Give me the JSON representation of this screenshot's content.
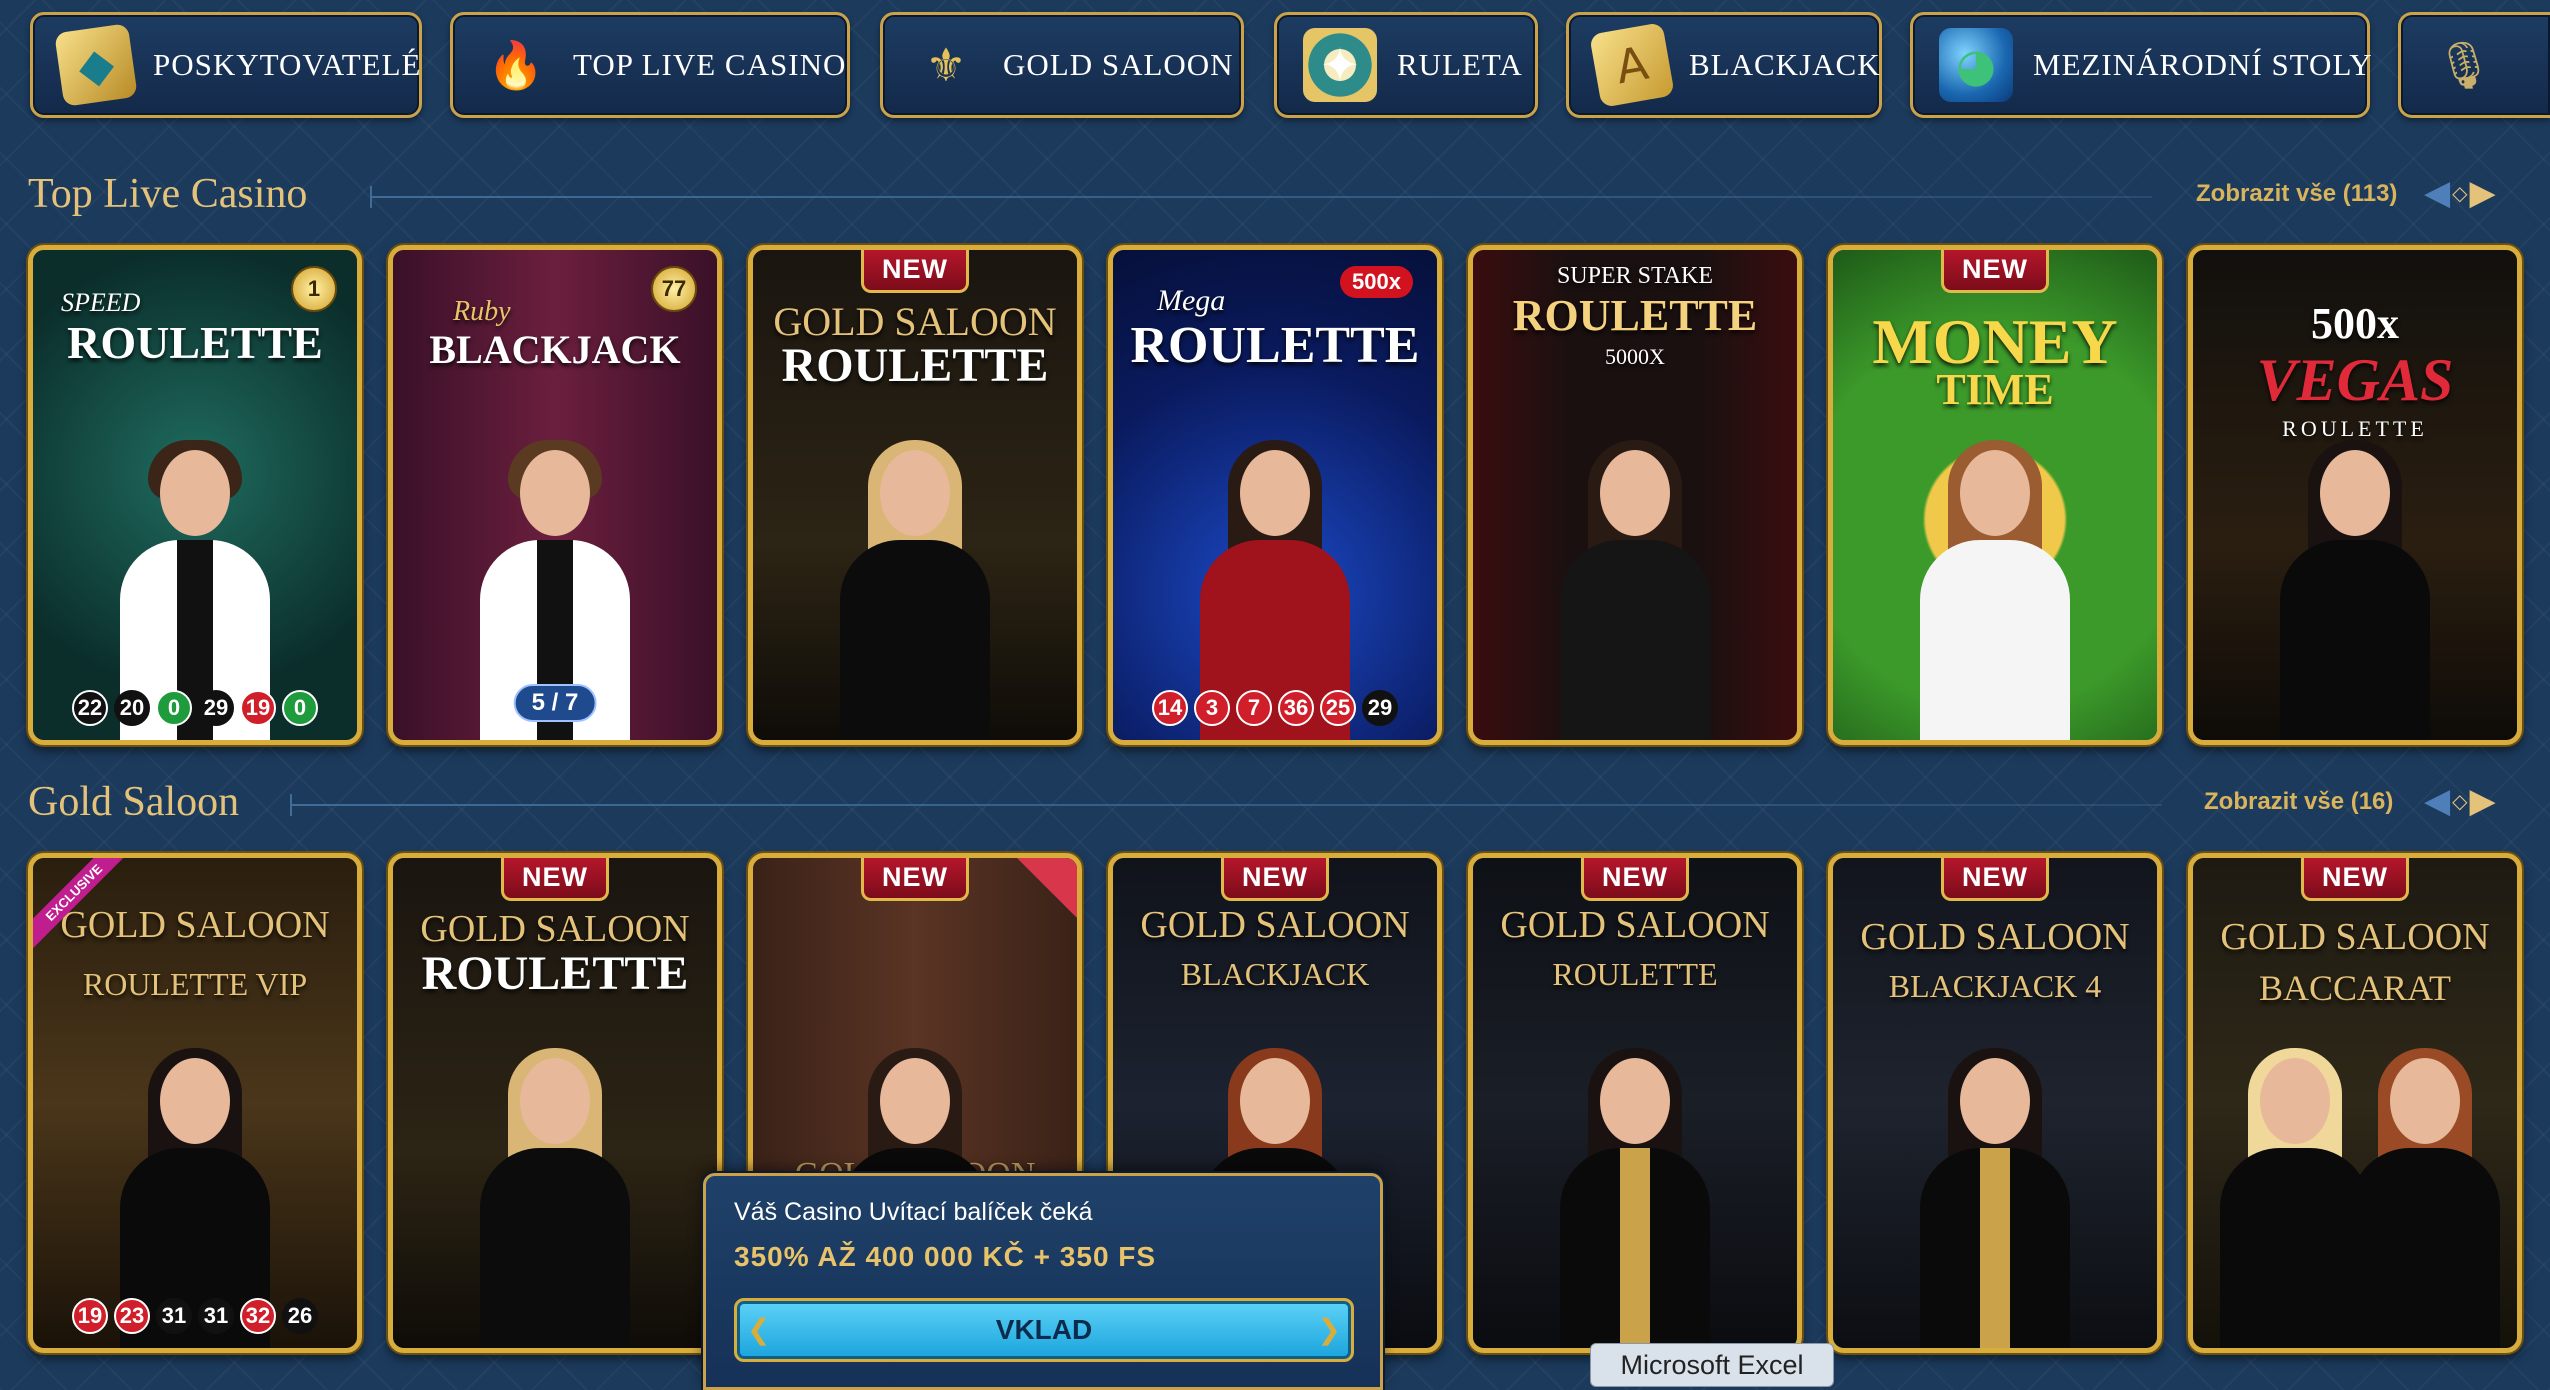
{
  "categories": [
    {
      "label": "POSKYTOVATELÉ",
      "icon": "providers-icon"
    },
    {
      "label": "TOP LIVE CASINO",
      "icon": "torch-icon"
    },
    {
      "label": "GOLD SALOON",
      "icon": "fleur-de-lis-icon"
    },
    {
      "label": "RULETA",
      "icon": "roulette-wheel-icon"
    },
    {
      "label": "BLACKJACK",
      "icon": "cards-icon"
    },
    {
      "label": "MEZINÁRODNÍ STOLY",
      "icon": "globe-icon"
    },
    {
      "label": "",
      "icon": "microphone-icon"
    }
  ],
  "sections": {
    "top_live": {
      "title": "Top Live Casino",
      "show_all": "Zobrazit vše (113)",
      "cards": [
        {
          "title": "ROULETTE",
          "subtitle": "SPEED",
          "badge": "1",
          "results": [
            "22",
            "20",
            "0",
            "29",
            "19",
            "0"
          ]
        },
        {
          "title": "BLACKJACK",
          "subtitle": "Ruby",
          "badge": "77",
          "players": "5 / 7"
        },
        {
          "new": "NEW",
          "title": "ROULETTE",
          "subtitle": "GOLD SALOON"
        },
        {
          "title": "ROULETTE",
          "subtitle": "Mega",
          "multiplier": "500x",
          "results": [
            "14",
            "3",
            "7",
            "36",
            "25",
            "29"
          ]
        },
        {
          "title": "ROULETTE",
          "subtitle": "SUPER STAKE",
          "tag": "5000X"
        },
        {
          "new": "NEW",
          "title": "MONEY",
          "subtitle": "TIME"
        },
        {
          "title": "VEGAS",
          "subtitle": "500x",
          "tag": "ROULETTE"
        }
      ]
    },
    "gold_saloon": {
      "title": "Gold Saloon",
      "show_all": "Zobrazit vše (16)",
      "cards": [
        {
          "title": "GOLD SALOON",
          "subtitle": "ROULETTE VIP",
          "exclusive": "EXCLUSIVE",
          "results": [
            "19",
            "23",
            "31",
            "31",
            "32",
            "26"
          ]
        },
        {
          "new": "NEW",
          "title": "GOLD SALOON",
          "subtitle": "ROULETTE"
        },
        {
          "new": "NEW",
          "title": "GOLD SALOON",
          "subtitle": ""
        },
        {
          "new": "NEW",
          "title": "GOLD SALOON",
          "subtitle": "BLACKJACK"
        },
        {
          "new": "NEW",
          "title": "GOLD SALOON",
          "subtitle": "ROULETTE"
        },
        {
          "new": "NEW",
          "title": "GOLD SALOON",
          "subtitle": "BLACKJACK 4"
        },
        {
          "new": "NEW",
          "title": "GOLD SALOON",
          "subtitle": "BACCARAT"
        }
      ]
    }
  },
  "popup": {
    "line1": "Váš Casino Uvítací balíček čeká",
    "line2": "350% AŽ 400 000 KČ + 350 FS",
    "button": "VKLAD"
  },
  "tooltip": "Microsoft Excel",
  "colors": {
    "gold": "#d9ad3c",
    "background": "#1c3a5c",
    "new_badge": "#b5162b",
    "title_gold": "#e4c27a"
  }
}
